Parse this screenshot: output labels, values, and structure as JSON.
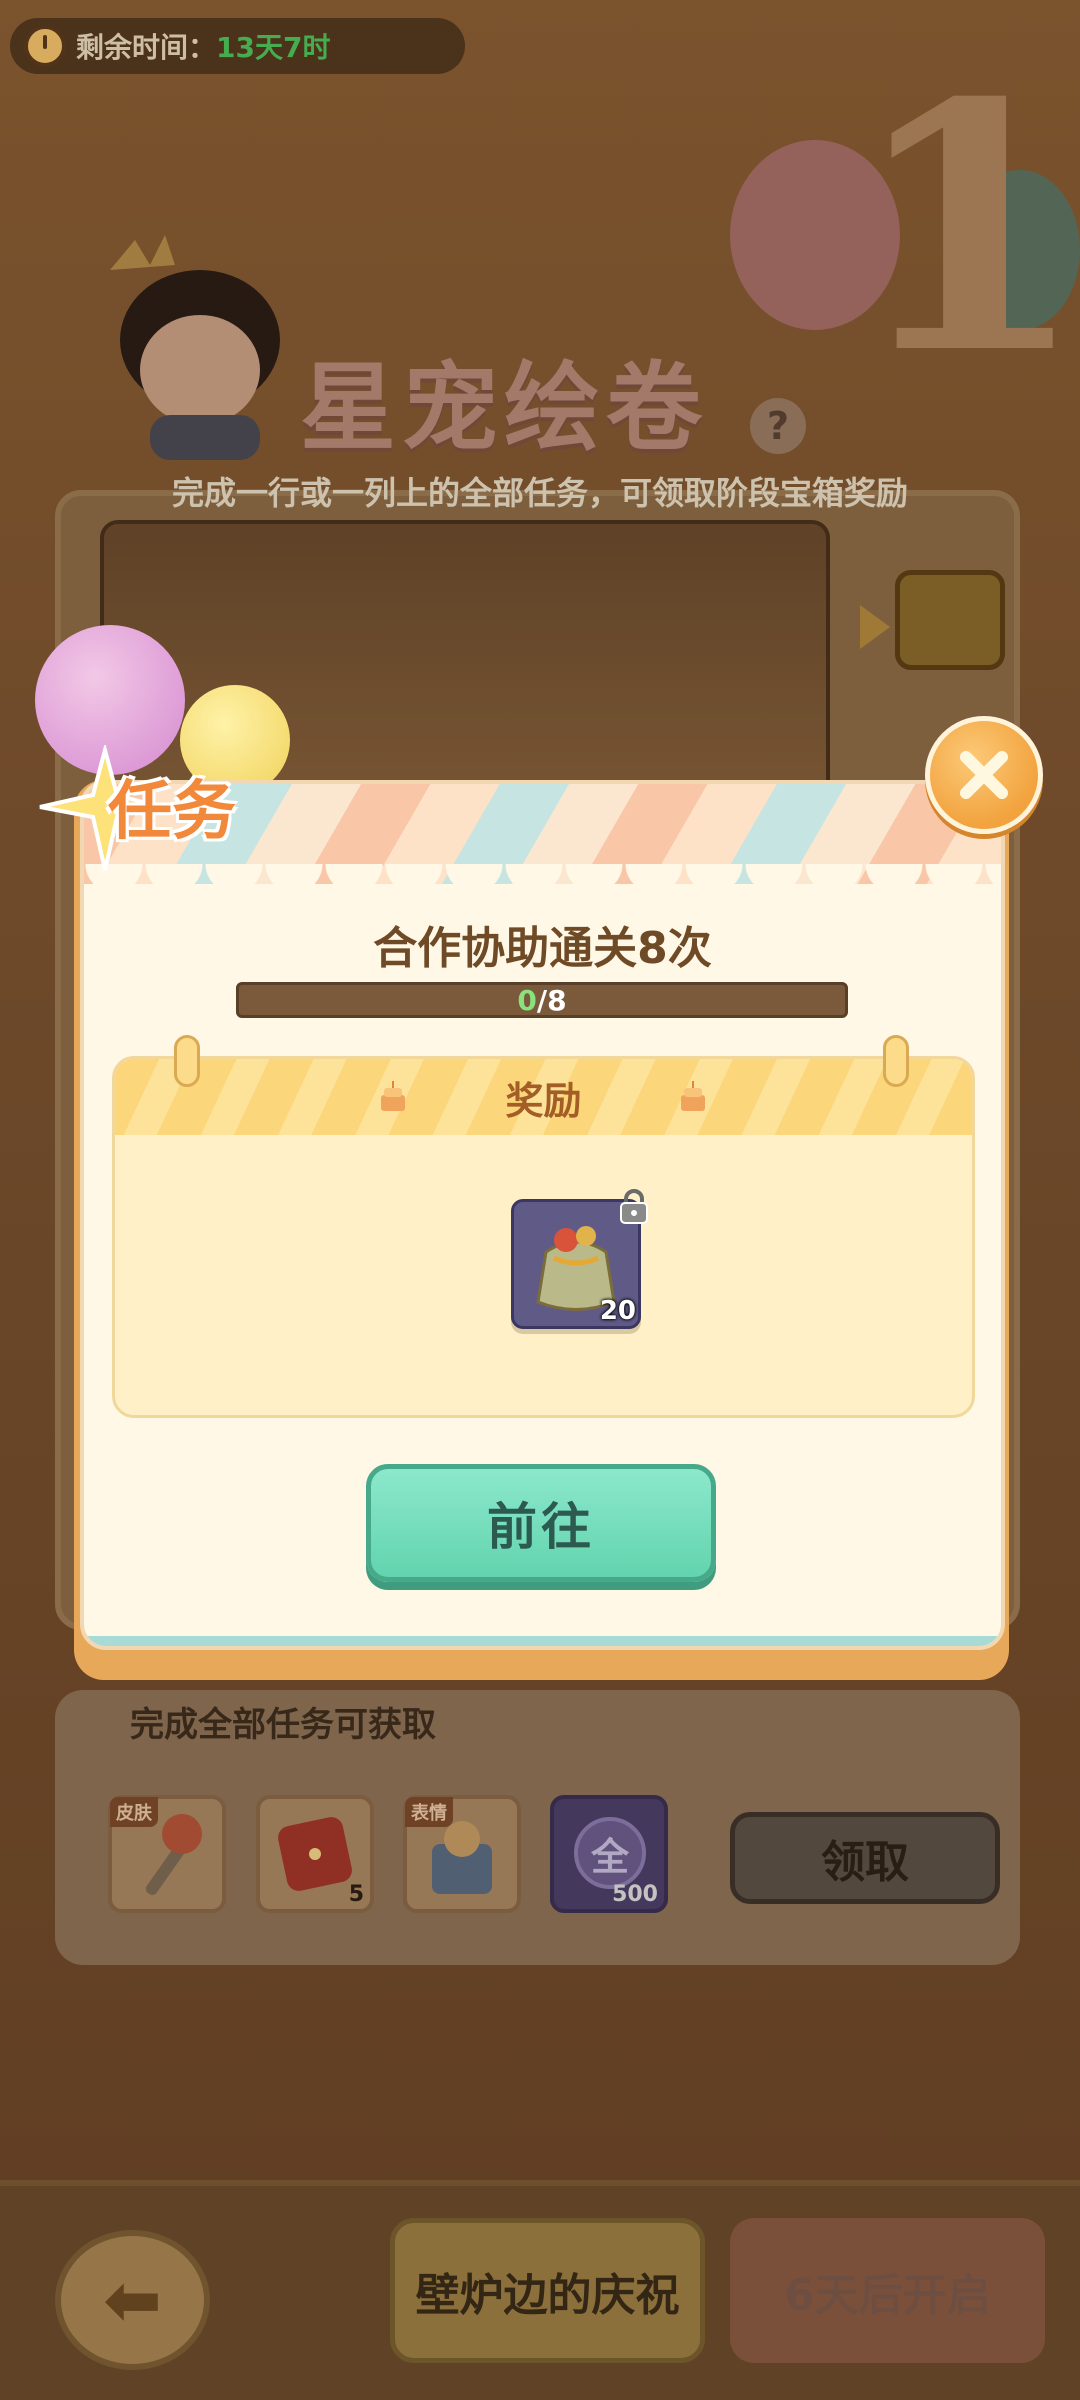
{
  "timer": {
    "label": "剩余时间：",
    "value": "13天7时"
  },
  "banner": {
    "title": "星宠绘卷",
    "help": "?"
  },
  "board": {
    "instruction": "完成一行或一列上的全部任务，可领取阶段宝箱奖励"
  },
  "modal": {
    "tab_label": "任务",
    "task_title": "合作协助通关8次",
    "progress": {
      "current": "0",
      "separator": "/",
      "total": "8",
      "fraction": 0
    },
    "reward_header": "奖励",
    "reward_item": {
      "icon": "gift-bag-icon",
      "count": "20",
      "locked": true
    },
    "go_button": "前往"
  },
  "final_rewards": {
    "caption": "完成全部任务可获取",
    "items": [
      {
        "tag": "皮肤",
        "icon": "skin-staff-icon",
        "count": ""
      },
      {
        "tag": "",
        "icon": "dice-icon",
        "count": "5"
      },
      {
        "tag": "表情",
        "icon": "emote-box-icon",
        "count": ""
      },
      {
        "tag": "",
        "icon": "all-coin-icon",
        "label": "全",
        "count": "500"
      }
    ],
    "claim_button": "领取"
  },
  "footer": {
    "active_chapter": "壁炉边的庆祝",
    "locked_chapter": "6天后开启"
  },
  "colors": {
    "accent_orange": "#f2893a",
    "go_green": "#62d4ae",
    "progress_green": "#76d36b"
  }
}
